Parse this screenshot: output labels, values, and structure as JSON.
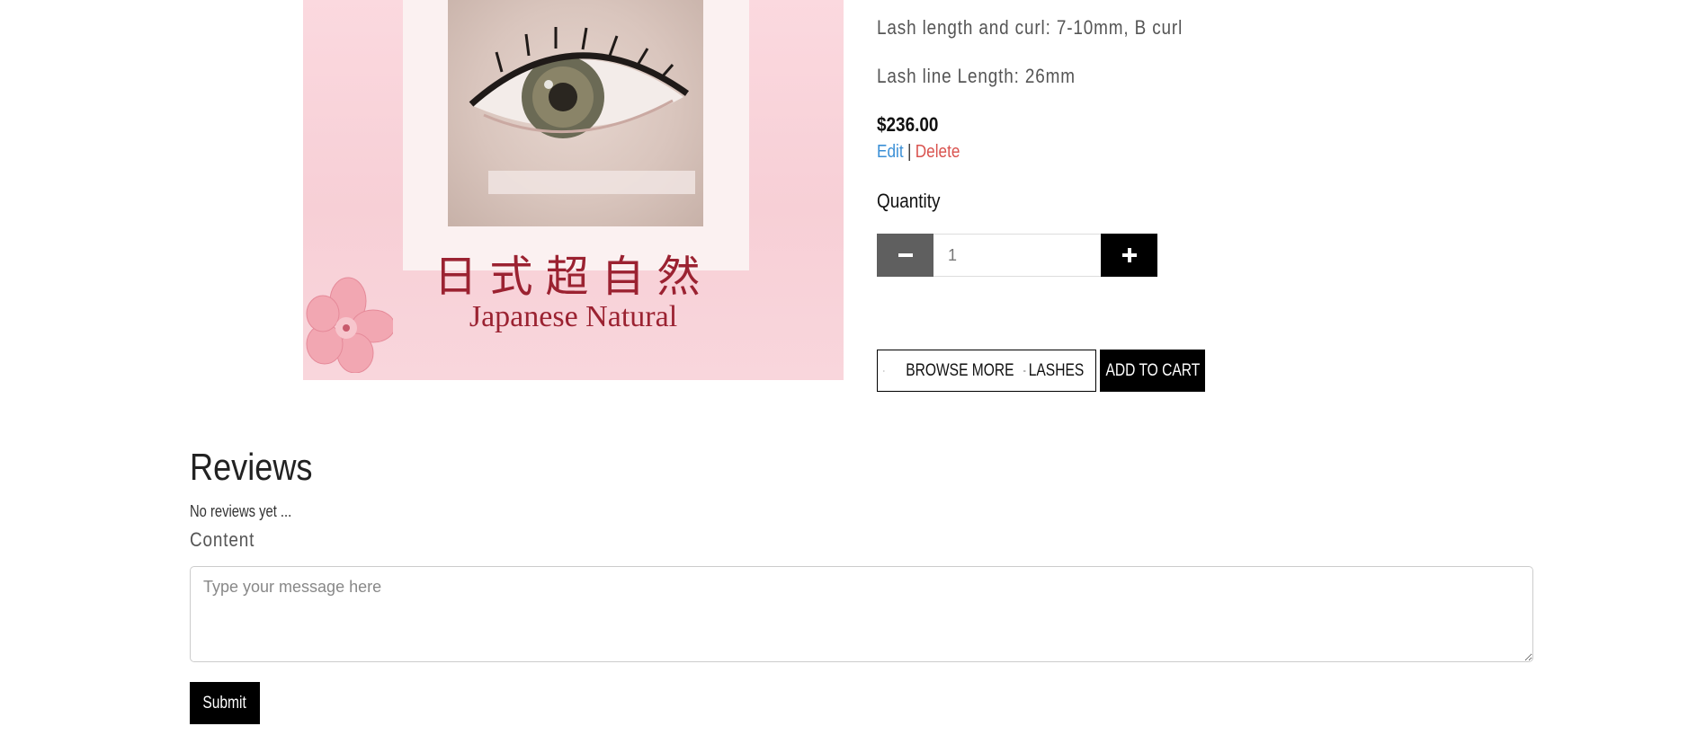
{
  "product": {
    "image_text_chinese": "日式超自然",
    "image_text_english": "Japanese Natural",
    "spec_length_curl": "Lash length and curl: 7-10mm, B curl",
    "spec_line_length": "Lash line Length: 26mm",
    "price": "$236.00",
    "edit_label": "Edit",
    "separator": "|",
    "delete_label": "Delete"
  },
  "quantity": {
    "label": "Quantity",
    "value": "1",
    "minus_icon": "minus-icon",
    "plus_icon": "plus-icon"
  },
  "actions": {
    "browse_label_prefix": "BROWSE MORE",
    "browse_label_suffix": "LASHES",
    "add_to_cart_label": "ADD TO CART",
    "icons": [
      "chevron-left-icon",
      "eye-icon"
    ]
  },
  "reviews": {
    "title": "Reviews",
    "empty_text": "No reviews yet ...",
    "content_label": "Content",
    "placeholder": "Type your message here",
    "submit_label": "Submit"
  },
  "colors": {
    "accent_dark": "#000000",
    "minus_button": "#5f5f5f",
    "edit_link": "#3a8fd6",
    "delete_link": "#d9534f",
    "image_background": "#f7cfd6",
    "image_text": "#9b2231"
  }
}
